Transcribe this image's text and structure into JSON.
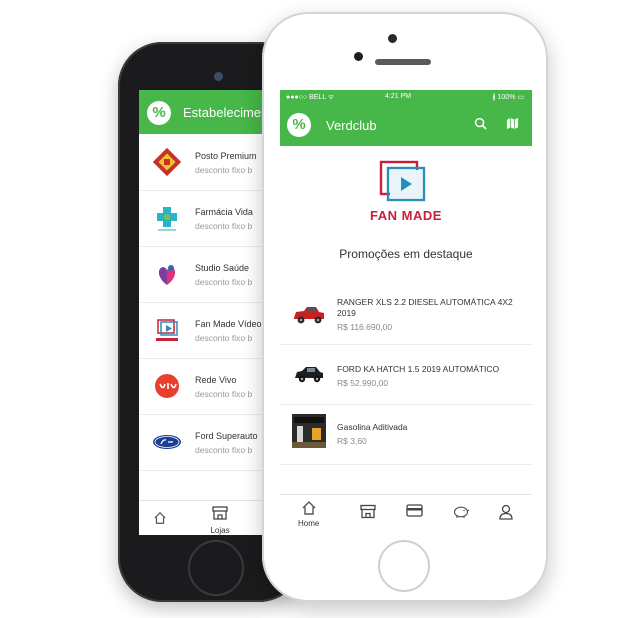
{
  "back_app": {
    "logo_glyph": "%",
    "title": "Estabelecimentos",
    "stores": [
      {
        "name": "Posto Premium",
        "subtitle": "desconto fixo b",
        "logo_icon": "posto-premium-logo"
      },
      {
        "name": "Farmácia Vida",
        "subtitle": "desconto fixo b",
        "logo_icon": "farmacia-vida-logo"
      },
      {
        "name": "Studio Saúde",
        "subtitle": "desconto fixo b",
        "logo_icon": "studio-saude-logo"
      },
      {
        "name": "Fan Made Vídeo",
        "subtitle": "desconto fixo b",
        "logo_icon": "fan-made-logo"
      },
      {
        "name": "Rede Vivo",
        "subtitle": "desconto fixo b",
        "logo_icon": "vivo-logo"
      },
      {
        "name": "Ford Superauto",
        "subtitle": "desconto fixo b",
        "logo_icon": "ford-logo"
      }
    ],
    "nav": {
      "home_icon": "home-icon",
      "stores_label": "Lojas"
    }
  },
  "front_app": {
    "status": {
      "carrier": "●●●○○ BELL ᯤ",
      "time": "4:21 PM",
      "battery": "∦ 100% ▭"
    },
    "logo_glyph": "%",
    "title": "Verdclub",
    "header_icons": [
      "search-icon",
      "map-icon"
    ],
    "brand": {
      "name": "FAN MADE"
    },
    "section_title": "Promoções em destaque",
    "promotions": [
      {
        "name": "RANGER XLS 2.2 DIESEL AUTOMÁTICA 4X2 2019",
        "price": "R$ 116.690,00",
        "image": "red-pickup-truck"
      },
      {
        "name": "FORD KA HATCH 1.5 2019 AUTOMÁTICO",
        "price": "R$ 52.990,00",
        "image": "black-hatchback"
      },
      {
        "name": "Gasolina Aditivada",
        "price": "R$ 3,60",
        "image": "gas-station"
      }
    ],
    "nav": {
      "home_label": "Home",
      "icons": [
        "home-icon",
        "store-icon",
        "card-icon",
        "piggy-bank-icon",
        "user-icon"
      ]
    }
  },
  "colors": {
    "brand_green": "#46b748",
    "fanmade_red": "#c8203a",
    "fanmade_blue": "#2a8fb8"
  }
}
